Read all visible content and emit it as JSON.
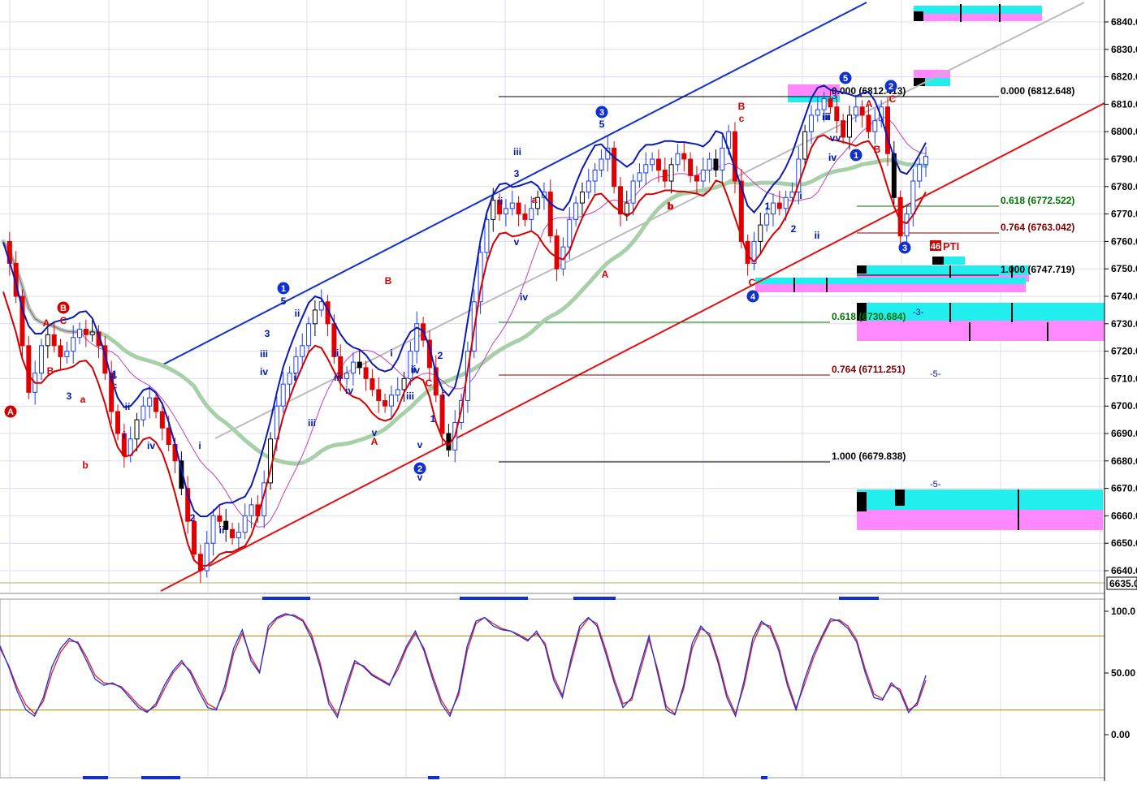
{
  "colors": {
    "background": "#ffffff",
    "grid": "#dcdcf0",
    "candle_up": "#1a3cff",
    "candle_down": "#e00000",
    "candle_neutral": "#000000",
    "upper_band": "#0a1ab4",
    "lower_band": "#d40000",
    "middle_ma": "#c040c0",
    "long_ma": "#a8d0a8",
    "channel_blue": "#1030d0",
    "channel_red": "#e01010",
    "channel_gray": "#bbbbbb",
    "fib_black": "#000000",
    "fib_green": "#007000",
    "fib_darkred": "#800000",
    "box_cyan": "#22eeee",
    "box_pink": "#ff88ff",
    "osc_blue": "#1a30e0",
    "osc_red": "#e02020",
    "osc_band": "#a08a00",
    "wave_blue": "#0018b0",
    "wave_red": "#d40000",
    "marker_blue": "#1030d0"
  },
  "price_axis": {
    "ticks": [
      "6840.0",
      "6830.0",
      "6820.0",
      "6810.0",
      "6800.0",
      "6790.0",
      "6780.0",
      "6770.0",
      "6760.0",
      "6750.0",
      "6740.0",
      "6730.0",
      "6720.0",
      "6710.0",
      "6700.0",
      "6690.0",
      "6680.0",
      "6670.0",
      "6660.0",
      "6650.0",
      "6640.0"
    ],
    "current_label": "6635.0"
  },
  "osc_axis": {
    "ticks": [
      "100.0",
      "50.00",
      "0.00"
    ]
  },
  "fib_labels": [
    {
      "text": "0.000 (6812.648)",
      "color": "fib_black"
    },
    {
      "text": "0.618 (6772.522)",
      "color": "fib_green"
    },
    {
      "text": "0.764 (6763.042)",
      "color": "fib_darkred"
    },
    {
      "text": "1.000 (6747.719)",
      "color": "fib_black"
    },
    {
      "text": "0.000 (6812.413)",
      "color": "fib_black"
    },
    {
      "text": "0.618 (6730.684)",
      "color": "fib_green"
    },
    {
      "text": "0.764 (6711.251)",
      "color": "fib_darkred"
    },
    {
      "text": "1.000 (6679.838)",
      "color": "fib_black"
    }
  ],
  "box_labels": [
    "-3-",
    "-5-",
    "-5-",
    "3"
  ],
  "pti_label": "PTI",
  "pti_value": "46",
  "wave_circles": [
    {
      "text": "A",
      "color": "wave_red"
    },
    {
      "text": "B",
      "color": "wave_red"
    },
    {
      "text": "1",
      "color": "marker_blue"
    },
    {
      "text": "2",
      "color": "marker_blue"
    },
    {
      "text": "3",
      "color": "marker_blue"
    },
    {
      "text": "4",
      "color": "marker_blue"
    },
    {
      "text": "5",
      "color": "marker_blue"
    },
    {
      "text": "1",
      "color": "marker_blue"
    },
    {
      "text": "2",
      "color": "marker_blue"
    },
    {
      "text": "3",
      "color": "marker_blue"
    }
  ],
  "wave_labels": [
    {
      "text": "A",
      "color": "wave_red"
    },
    {
      "text": "C",
      "color": "wave_red"
    },
    {
      "text": "B",
      "color": "wave_red"
    },
    {
      "text": "a",
      "color": "wave_red"
    },
    {
      "text": "b",
      "color": "wave_red"
    },
    {
      "text": "c",
      "color": "wave_red"
    },
    {
      "text": "1",
      "color": "wave_blue"
    },
    {
      "text": "3",
      "color": "wave_blue"
    },
    {
      "text": "4",
      "color": "wave_blue"
    },
    {
      "text": "i",
      "color": "wave_blue"
    },
    {
      "text": "ii",
      "color": "wave_blue"
    },
    {
      "text": "iv",
      "color": "wave_blue"
    },
    {
      "text": "i",
      "color": "wave_blue"
    },
    {
      "text": "ii",
      "color": "wave_blue"
    },
    {
      "text": "2",
      "color": "wave_blue"
    },
    {
      "text": "3",
      "color": "wave_blue"
    },
    {
      "text": "5",
      "color": "wave_blue"
    },
    {
      "text": "iii",
      "color": "wave_blue"
    },
    {
      "text": "iv",
      "color": "wave_blue"
    },
    {
      "text": "iii",
      "color": "wave_blue"
    },
    {
      "text": "ii",
      "color": "wave_blue"
    },
    {
      "text": "i",
      "color": "wave_blue"
    },
    {
      "text": "ii",
      "color": "wave_blue"
    },
    {
      "text": "iii",
      "color": "wave_blue"
    },
    {
      "text": "iv",
      "color": "wave_blue"
    },
    {
      "text": "v",
      "color": "wave_blue"
    },
    {
      "text": "A",
      "color": "wave_red"
    },
    {
      "text": "B",
      "color": "wave_red"
    },
    {
      "text": "i",
      "color": "wave_blue"
    },
    {
      "text": "ii",
      "color": "wave_blue"
    },
    {
      "text": "iii",
      "color": "wave_blue"
    },
    {
      "text": "iv",
      "color": "wave_blue"
    },
    {
      "text": "v",
      "color": "wave_blue"
    },
    {
      "text": "v",
      "color": "wave_blue"
    },
    {
      "text": "C",
      "color": "wave_red"
    },
    {
      "text": "1",
      "color": "wave_blue"
    },
    {
      "text": "2",
      "color": "wave_blue"
    },
    {
      "text": "i",
      "color": "wave_blue"
    },
    {
      "text": "ii",
      "color": "wave_blue"
    },
    {
      "text": "iii",
      "color": "wave_blue"
    },
    {
      "text": "3",
      "color": "wave_blue"
    },
    {
      "text": "v",
      "color": "wave_blue"
    },
    {
      "text": "iv",
      "color": "wave_blue"
    },
    {
      "text": "a",
      "color": "wave_red"
    },
    {
      "text": "b",
      "color": "wave_red"
    },
    {
      "text": "5",
      "color": "wave_blue"
    },
    {
      "text": "A",
      "color": "wave_red"
    },
    {
      "text": "b",
      "color": "wave_red"
    },
    {
      "text": "B",
      "color": "wave_red"
    },
    {
      "text": "c",
      "color": "wave_red"
    },
    {
      "text": "C",
      "color": "wave_red"
    },
    {
      "text": "1",
      "color": "wave_blue"
    },
    {
      "text": "2",
      "color": "wave_blue"
    },
    {
      "text": "i",
      "color": "wave_blue"
    },
    {
      "text": "ii",
      "color": "wave_blue"
    },
    {
      "text": "iii",
      "color": "wave_blue"
    },
    {
      "text": "iv",
      "color": "wave_blue"
    },
    {
      "text": "v",
      "color": "wave_blue"
    },
    {
      "text": "A",
      "color": "wave_red"
    },
    {
      "text": "B",
      "color": "wave_red"
    },
    {
      "text": "C",
      "color": "wave_red"
    },
    {
      "text": "i",
      "color": "wave_blue"
    },
    {
      "text": "ii",
      "color": "wave_blue"
    },
    {
      "text": "iii",
      "color": "wave_blue"
    },
    {
      "text": "iv",
      "color": "wave_blue"
    },
    {
      "text": "v",
      "color": "wave_blue"
    }
  ],
  "chart_data": {
    "type": "candlestick",
    "title": "",
    "xlabel": "",
    "ylabel": "",
    "ylim": [
      6635,
      6845
    ],
    "grid": true,
    "price_series": [
      6760,
      6752,
      6740,
      6722,
      6705,
      6712,
      6722,
      6726,
      6722,
      6718,
      6720,
      6725,
      6728,
      6726,
      6727,
      6722,
      6712,
      6698,
      6690,
      6682,
      6688,
      6695,
      6700,
      6703,
      6698,
      6692,
      6686,
      6680,
      6670,
      6658,
      6646,
      6640,
      6650,
      6660,
      6658,
      6655,
      6652,
      6654,
      6660,
      6664,
      6660,
      6672,
      6688,
      6700,
      6708,
      6712,
      6718,
      6722,
      6730,
      6735,
      6738,
      6730,
      6718,
      6710,
      6712,
      6716,
      6714,
      6710,
      6706,
      6702,
      6700,
      6704,
      6706,
      6710,
      6720,
      6730,
      6724,
      6714,
      6704,
      6690,
      6684,
      6694,
      6702,
      6720,
      6738,
      6756,
      6768,
      6775,
      6770,
      6772,
      6774,
      6770,
      6768,
      6772,
      6776,
      6778,
      6762,
      6750,
      6758,
      6768,
      6774,
      6778,
      6782,
      6786,
      6790,
      6794,
      6780,
      6770,
      6774,
      6782,
      6785,
      6788,
      6790,
      6786,
      6782,
      6788,
      6792,
      6790,
      6784,
      6782,
      6786,
      6790,
      6786,
      6794,
      6800,
      6782,
      6760,
      6752,
      6760,
      6766,
      6770,
      6774,
      6772,
      6776,
      6778,
      6790,
      6800,
      6806,
      6808,
      6812,
      6809,
      6804,
      6798,
      6806,
      6809,
      6806,
      6800,
      6804,
      6809,
      6792,
      6776,
      6762,
      6770,
      6782,
      6788,
      6791
    ],
    "oscillator": {
      "name": "stochastic",
      "ylim": [
        0,
        100
      ],
      "bands": [
        80,
        20
      ],
      "fast": [
        72,
        55,
        35,
        20,
        15,
        30,
        55,
        70,
        78,
        74,
        60,
        45,
        40,
        42,
        38,
        30,
        22,
        18,
        25,
        40,
        52,
        60,
        50,
        35,
        22,
        20,
        40,
        70,
        85,
        60,
        50,
        88,
        95,
        98,
        96,
        92,
        78,
        55,
        25,
        14,
        40,
        60,
        55,
        48,
        44,
        40,
        56,
        72,
        84,
        68,
        45,
        25,
        15,
        35,
        72,
        92,
        95,
        88,
        85,
        84,
        80,
        76,
        84,
        72,
        44,
        30,
        62,
        88,
        95,
        88,
        66,
        42,
        22,
        30,
        56,
        80,
        50,
        20,
        16,
        40,
        74,
        88,
        80,
        58,
        30,
        15,
        44,
        78,
        92,
        86,
        68,
        40,
        20,
        45,
        65,
        80,
        94,
        92,
        86,
        75,
        50,
        30,
        28,
        42,
        35,
        18,
        26,
        48
      ],
      "slow": [
        70,
        56,
        38,
        24,
        17,
        27,
        50,
        67,
        76,
        75,
        63,
        48,
        42,
        41,
        39,
        32,
        24,
        19,
        23,
        37,
        50,
        58,
        52,
        38,
        25,
        21,
        36,
        66,
        82,
        63,
        51,
        85,
        94,
        97,
        97,
        93,
        81,
        58,
        28,
        16,
        36,
        58,
        56,
        49,
        45,
        41,
        53,
        70,
        82,
        70,
        48,
        28,
        17,
        32,
        68,
        90,
        95,
        90,
        86,
        84,
        81,
        77,
        82,
        74,
        47,
        32,
        58,
        85,
        94,
        90,
        69,
        45,
        25,
        28,
        52,
        77,
        53,
        23,
        17,
        37,
        70,
        86,
        82,
        61,
        33,
        17,
        40,
        74,
        90,
        88,
        71,
        43,
        22,
        41,
        62,
        78,
        92,
        93,
        88,
        77,
        53,
        33,
        29,
        40,
        37,
        20,
        24,
        44
      ]
    }
  }
}
